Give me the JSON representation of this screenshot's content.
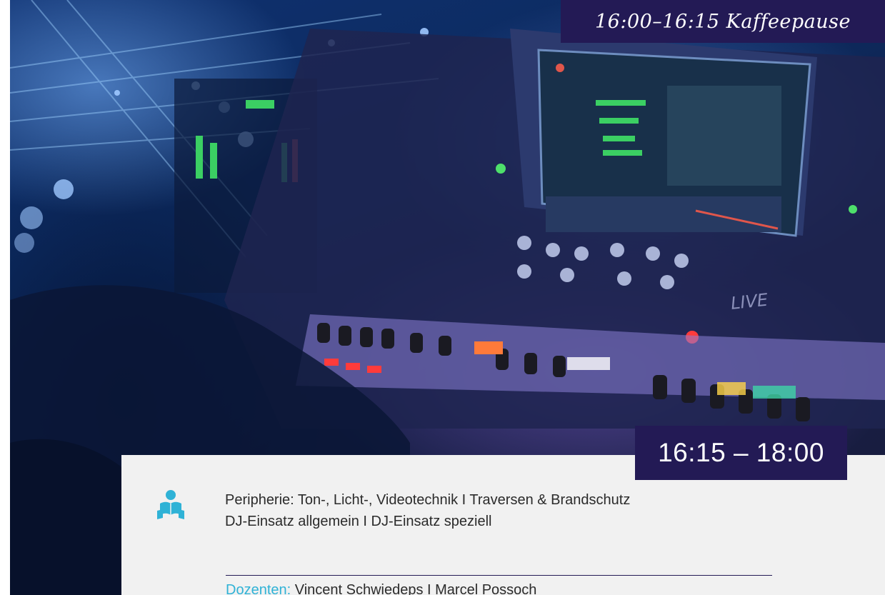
{
  "pause_banner": {
    "text": "16:00–16:15 Kaffeepause"
  },
  "session": {
    "time": "16:15 – 18:00",
    "icon": "reader-icon",
    "topics": [
      "Peripherie: Ton-, Licht-, Videotechnik I Traversen & Brandschutz",
      "DJ-Einsatz allgemein I DJ-Einsatz speziell"
    ],
    "lecturers_label": "Dozenten:",
    "lecturers_names": " Vincent Schwiedeps I Marcel Possoch"
  },
  "colors": {
    "brand_navy": "#231a55",
    "accent_cyan": "#2fb2d6",
    "panel_bg": "#f1f1f1",
    "text": "#2b2b2b"
  },
  "photo": {
    "subject": "mixing-console"
  }
}
